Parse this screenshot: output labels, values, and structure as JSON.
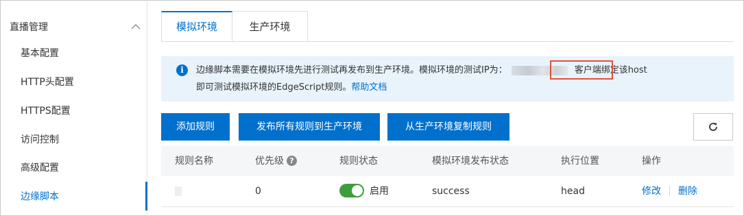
{
  "sidebar": {
    "group_label": "直播管理",
    "items": [
      {
        "label": "基本配置"
      },
      {
        "label": "HTTP头配置"
      },
      {
        "label": "HTTPS配置"
      },
      {
        "label": "访问控制"
      },
      {
        "label": "高级配置"
      },
      {
        "label": "边缘脚本"
      }
    ],
    "active_item": "边缘脚本"
  },
  "tabs": [
    {
      "label": "模拟环境",
      "active": true
    },
    {
      "label": "生产环境",
      "active": false
    }
  ],
  "notice": {
    "line1_before_ip": "边缘脚本需要在模拟环境先进行测试再发布到生产环境。模拟环境的测试IP为：",
    "line1_after_ip": "客户端绑定该host",
    "line2_text": "即可测试模拟环境的EdgeScript规则。",
    "help_link": "帮助文档"
  },
  "toolbar": {
    "add_rule": "添加规则",
    "publish_all": "发布所有规则到生产环境",
    "copy_from_prod": "从生产环境复制规则",
    "refresh_icon": "refresh-icon"
  },
  "table": {
    "columns": [
      "规则名称",
      "优先级",
      "规则状态",
      "模拟环境发布状态",
      "执行位置",
      "操作"
    ],
    "rows": [
      {
        "name": "",
        "priority": "0",
        "status_enabled": true,
        "status_label": "启用",
        "publish_status": "success",
        "position": "head",
        "actions": [
          "修改",
          "删除"
        ]
      }
    ]
  },
  "colors": {
    "accent": "#0070cc",
    "toggle_on": "#3d9c3d",
    "notice_bg": "#e8f3fc",
    "highlight_box": "#e0513b"
  }
}
